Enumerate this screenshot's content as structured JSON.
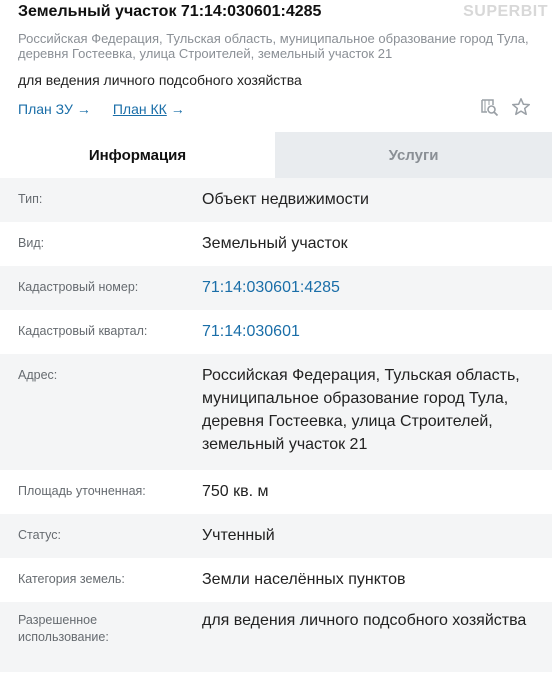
{
  "header": {
    "title": "Земельный участок 71:14:030601:4285",
    "watermark": "SUPERBIT",
    "address": "Российская Федерация, Тульская область, муниципальное образование город Тула, деревня Гостеевка, улица Строителей, земельный участок 21",
    "purpose": "для ведения личного подсобного хозяйства",
    "links": [
      {
        "label": "План ЗУ",
        "arrow": "→"
      },
      {
        "label": "План КК",
        "arrow": "→"
      }
    ]
  },
  "tabs": [
    {
      "label": "Информация",
      "active": true
    },
    {
      "label": "Услуги",
      "active": false
    }
  ],
  "details": [
    {
      "label": "Тип:",
      "value": "Объект недвижимости",
      "link": false
    },
    {
      "label": "Вид:",
      "value": "Земельный участок",
      "link": false
    },
    {
      "label": "Кадастровый номер:",
      "value": "71:14:030601:4285",
      "link": true
    },
    {
      "label": "Кадастровый квартал:",
      "value": "71:14:030601",
      "link": true
    },
    {
      "label": "Адрес:",
      "value": "Российская Федерация, Тульская область, муниципальное образование город Тула, деревня Гостеевка, улица Строителей, земельный участок 21",
      "link": false
    },
    {
      "label": "Площадь уточненная:",
      "value": "750 кв. м",
      "link": false
    },
    {
      "label": "Статус:",
      "value": "Учтенный",
      "link": false
    },
    {
      "label": "Категория земель:",
      "value": "Земли населённых пунктов",
      "link": false
    },
    {
      "label": "Разрешенное использование:",
      "value": "для ведения личного подсобного хозяйства",
      "link": false
    }
  ],
  "colors": {
    "link": "#1a6ea8",
    "shade": "#f4f5f6",
    "tab_inactive": "#e9ecef"
  },
  "icons": {
    "map_search": "map-search-icon",
    "favorite": "star-icon"
  }
}
